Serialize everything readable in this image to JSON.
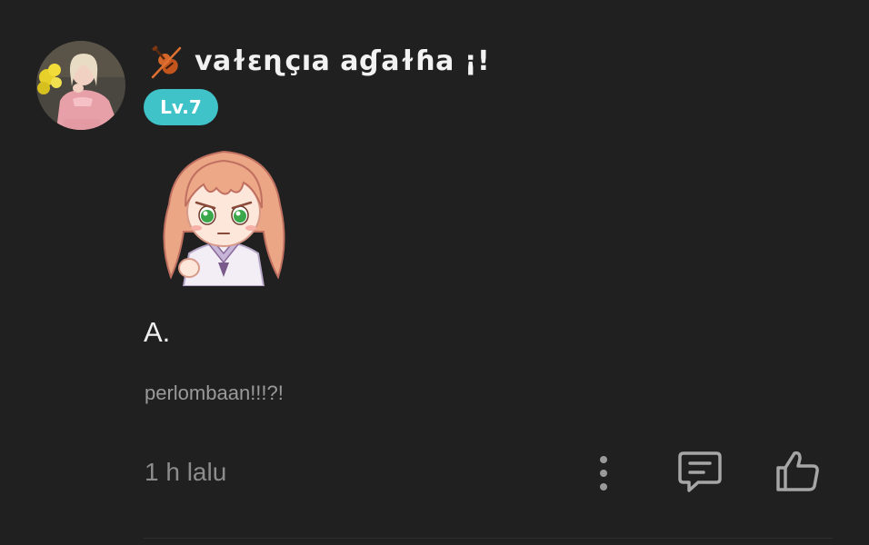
{
  "post": {
    "author": {
      "avatar_icon": "user-avatar-photo",
      "name_icon": "violin-emoji-icon",
      "name": "vaɫɛɳçıa aɠaɫɦa ¡!",
      "level": "Lv.7",
      "level_color": "#3fc3c8"
    },
    "sticker_icon": "anime-girl-sticker",
    "title": "A.",
    "body": "perlombaan!!!?!",
    "time": "1 h lalu"
  },
  "actions": {
    "more_icon": "more-vertical-icon",
    "comment_icon": "comment-icon",
    "like_icon": "thumbs-up-icon"
  }
}
